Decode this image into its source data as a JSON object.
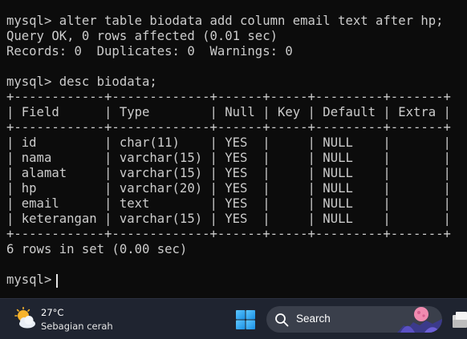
{
  "terminal": {
    "lines": [
      "mysql> alter table biodata add column email text after hp;",
      "Query OK, 0 rows affected (0.01 sec)",
      "Records: 0  Duplicates: 0  Warnings: 0",
      "",
      "mysql> desc biodata;",
      "+------------+-------------+------+-----+---------+-------+",
      "| Field      | Type        | Null | Key | Default | Extra |",
      "+------------+-------------+------+-----+---------+-------+",
      "| id         | char(11)    | YES  |     | NULL    |       |",
      "| nama       | varchar(15) | YES  |     | NULL    |       |",
      "| alamat     | varchar(15) | YES  |     | NULL    |       |",
      "| hp         | varchar(20) | YES  |     | NULL    |       |",
      "| email      | text        | YES  |     | NULL    |       |",
      "| keterangan | varchar(15) | YES  |     | NULL    |       |",
      "+------------+-------------+------+-----+---------+-------+",
      "6 rows in set (0.00 sec)",
      "",
      "mysql> "
    ],
    "colors": {
      "background": "#0c0c0c",
      "text": "#cccccc"
    }
  },
  "taskbar": {
    "weather": {
      "temperature": "27°C",
      "condition": "Sebagian cerah",
      "icon": "partly-sunny-icon"
    },
    "start_icon": "windows-logo-icon",
    "search": {
      "label": "Search",
      "icon": "search-icon"
    },
    "app_icon": "file-explorer-icon"
  }
}
